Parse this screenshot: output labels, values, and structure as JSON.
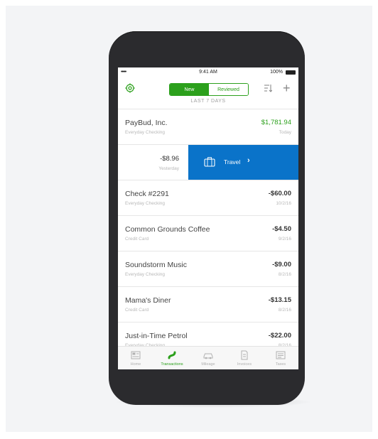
{
  "status_bar": {
    "signal": "•••••",
    "time": "9:41 AM",
    "battery": "100%"
  },
  "nav": {
    "segment_new": "New",
    "segment_reviewed": "Reviewed",
    "subtitle": "LAST 7 DAYS"
  },
  "transactions": [
    {
      "name": "PayBud, Inc.",
      "account": "Everyday Checking",
      "amount": "$1,781.94",
      "date": "Today"
    },
    {
      "name": "",
      "account": "",
      "amount": "-$8.96",
      "date": "Yesterday",
      "action": "Travel"
    },
    {
      "name": "Check #2291",
      "account": "Everyday Checking",
      "amount": "-$60.00",
      "date": "10/2/16"
    },
    {
      "name": "Common Grounds Coffee",
      "account": "Credit Card",
      "amount": "-$4.50",
      "date": "9/2/16"
    },
    {
      "name": "Soundstorm Music",
      "account": "Everyday Checking",
      "amount": "-$9.00",
      "date": "8/2/16"
    },
    {
      "name": "Mama's Diner",
      "account": "Credit Card",
      "amount": "-$13.15",
      "date": "8/2/16"
    },
    {
      "name": "Just-in-Time Petrol",
      "account": "Everyday Checking",
      "amount": "-$22.00",
      "date": "8/2/16"
    }
  ],
  "tabs": [
    {
      "label": "Home",
      "icon": "home-icon"
    },
    {
      "label": "Transactions",
      "icon": "transactions-icon"
    },
    {
      "label": "Mileage",
      "icon": "car-icon"
    },
    {
      "label": "Invoices",
      "icon": "invoice-icon"
    },
    {
      "label": "Taxes",
      "icon": "taxes-icon"
    }
  ],
  "colors": {
    "brand_green": "#2ca01c",
    "action_blue": "#0a73c9"
  }
}
